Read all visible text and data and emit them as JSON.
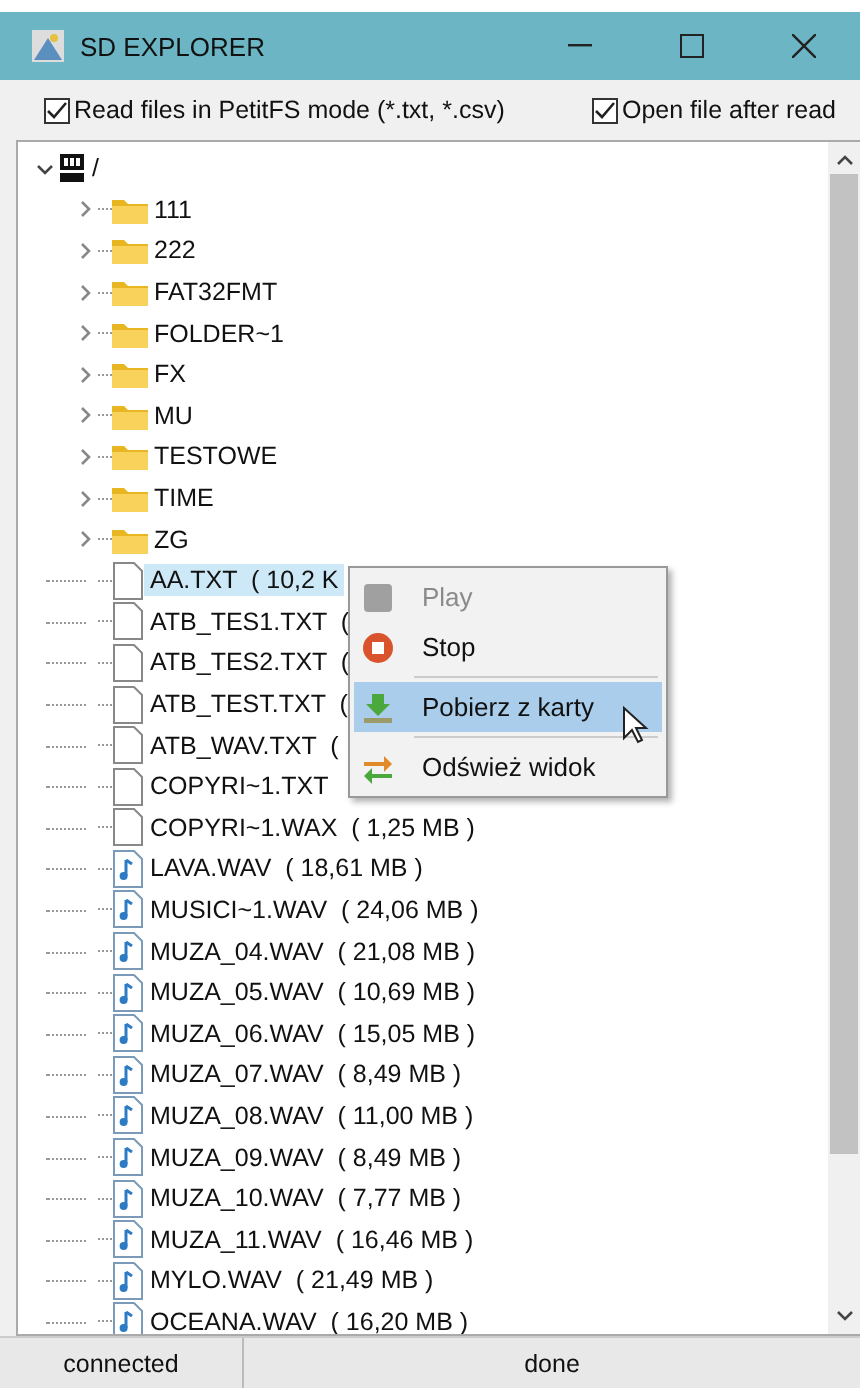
{
  "window": {
    "title": "SD EXPLORER"
  },
  "options": [
    {
      "label": "Read files in PetitFS mode (*.txt, *.csv)",
      "checked": true
    },
    {
      "label": "Open file after read",
      "checked": true
    }
  ],
  "tree": {
    "label": "/",
    "expanded": true,
    "children": [
      {
        "kind": "folder",
        "label": "111",
        "expanded": false,
        "selected": false
      },
      {
        "kind": "folder",
        "label": "222",
        "expanded": false,
        "selected": false
      },
      {
        "kind": "folder",
        "label": "FAT32FMT",
        "expanded": false,
        "selected": false
      },
      {
        "kind": "folder",
        "label": "FOLDER~1",
        "expanded": false,
        "selected": false
      },
      {
        "kind": "folder",
        "label": "FX",
        "expanded": false,
        "selected": false
      },
      {
        "kind": "folder",
        "label": "MU",
        "expanded": false,
        "selected": false
      },
      {
        "kind": "folder",
        "label": "TESTOWE",
        "expanded": false,
        "selected": false
      },
      {
        "kind": "folder",
        "label": "TIME",
        "expanded": false,
        "selected": false
      },
      {
        "kind": "folder",
        "label": "ZG",
        "expanded": false,
        "selected": false
      },
      {
        "kind": "text",
        "label": "AA.TXT  ( 10,2 K",
        "selected": true
      },
      {
        "kind": "text",
        "label": "ATB_TES1.TXT  (",
        "selected": false
      },
      {
        "kind": "text",
        "label": "ATB_TES2.TXT  (",
        "selected": false
      },
      {
        "kind": "text",
        "label": "ATB_TEST.TXT  (",
        "selected": false
      },
      {
        "kind": "text",
        "label": "ATB_WAV.TXT  (",
        "selected": false
      },
      {
        "kind": "text",
        "label": "COPYRI~1.TXT",
        "selected": false
      },
      {
        "kind": "text",
        "label": "COPYRI~1.WAX  ( 1,25 MB )",
        "selected": false
      },
      {
        "kind": "audio",
        "label": "LAVA.WAV  ( 18,61 MB )",
        "selected": false
      },
      {
        "kind": "audio",
        "label": "MUSICI~1.WAV  ( 24,06 MB )",
        "selected": false
      },
      {
        "kind": "audio",
        "label": "MUZA_04.WAV  ( 21,08 MB )",
        "selected": false
      },
      {
        "kind": "audio",
        "label": "MUZA_05.WAV  ( 10,69 MB )",
        "selected": false
      },
      {
        "kind": "audio",
        "label": "MUZA_06.WAV  ( 15,05 MB )",
        "selected": false
      },
      {
        "kind": "audio",
        "label": "MUZA_07.WAV  ( 8,49 MB )",
        "selected": false
      },
      {
        "kind": "audio",
        "label": "MUZA_08.WAV  ( 11,00 MB )",
        "selected": false
      },
      {
        "kind": "audio",
        "label": "MUZA_09.WAV  ( 8,49 MB )",
        "selected": false
      },
      {
        "kind": "audio",
        "label": "MUZA_10.WAV  ( 7,77 MB )",
        "selected": false
      },
      {
        "kind": "audio",
        "label": "MUZA_11.WAV  ( 16,46 MB )",
        "selected": false
      },
      {
        "kind": "audio",
        "label": "MYLO.WAV  ( 21,49 MB )",
        "selected": false
      },
      {
        "kind": "audio",
        "label": "OCEANA.WAV  ( 16,20 MB )",
        "selected": false
      }
    ]
  },
  "context_menu": [
    {
      "kind": "play",
      "label": "Play",
      "disabled": true,
      "selected": false
    },
    {
      "kind": "stop",
      "label": "Stop",
      "disabled": false,
      "selected": false
    },
    {
      "kind": "download",
      "label": "Pobierz z karty",
      "disabled": false,
      "selected": true
    },
    {
      "kind": "refresh",
      "label": "Odśwież widok",
      "disabled": false,
      "selected": false
    }
  ],
  "status_bar": [
    "connected",
    "done"
  ]
}
